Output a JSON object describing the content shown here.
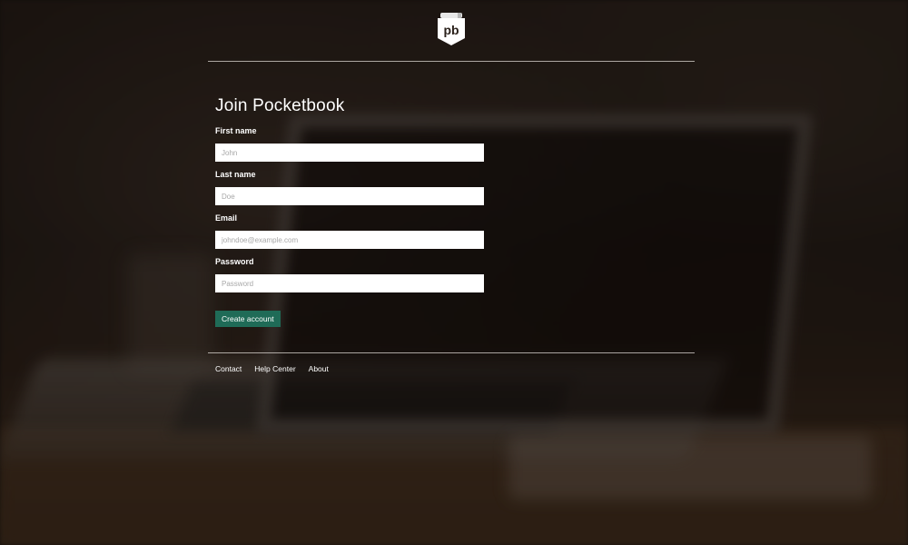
{
  "brand": {
    "logo_text": "pb",
    "logo_icon": "pocketbook-logo-icon"
  },
  "form": {
    "title": "Join Pocketbook",
    "fields": [
      {
        "label": "First name",
        "placeholder": "John",
        "value": ""
      },
      {
        "label": "Last name",
        "placeholder": "Doe",
        "value": ""
      },
      {
        "label": "Email",
        "placeholder": "johndoe@example.com",
        "value": ""
      },
      {
        "label": "Password",
        "placeholder": "Password",
        "value": ""
      }
    ],
    "submit_label": "Create account"
  },
  "footer": {
    "links": [
      "Contact",
      "Help Center",
      "About"
    ]
  },
  "colors": {
    "accent": "#1f6b57",
    "text": "#ffffff"
  }
}
